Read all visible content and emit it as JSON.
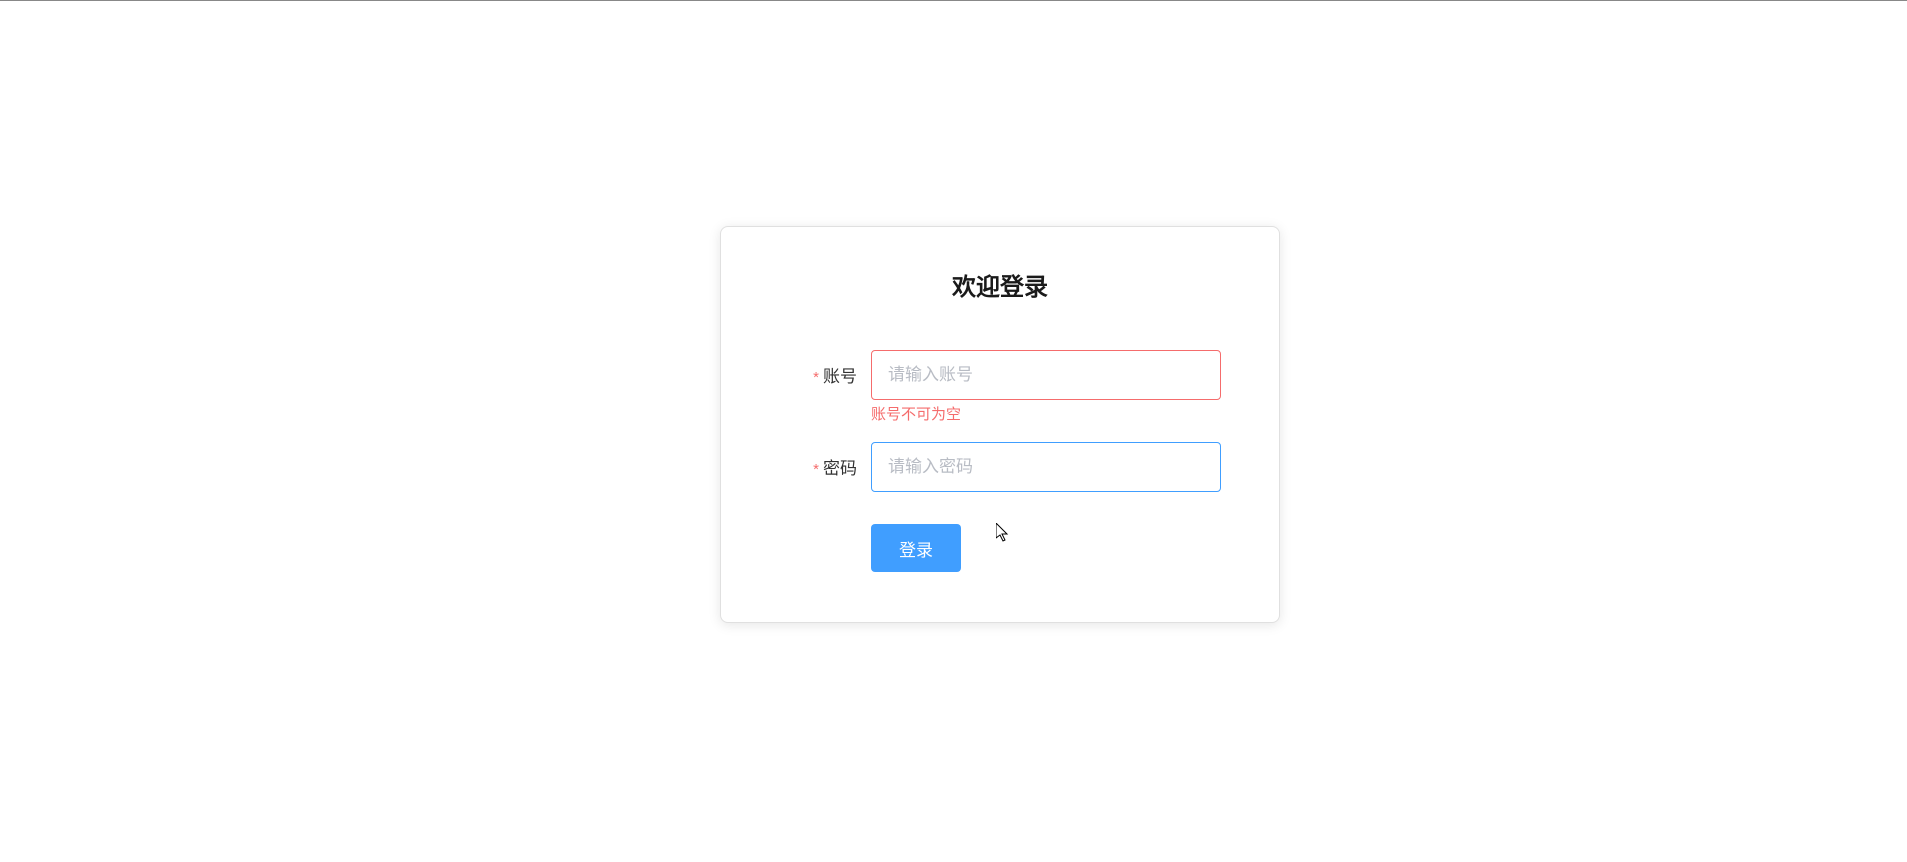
{
  "login": {
    "title": "欢迎登录",
    "account": {
      "label": "账号",
      "placeholder": "请输入账号",
      "value": "",
      "error": "账号不可为空"
    },
    "password": {
      "label": "密码",
      "placeholder": "请输入密码",
      "value": ""
    },
    "submit_label": "登录",
    "required_mark": "*"
  }
}
